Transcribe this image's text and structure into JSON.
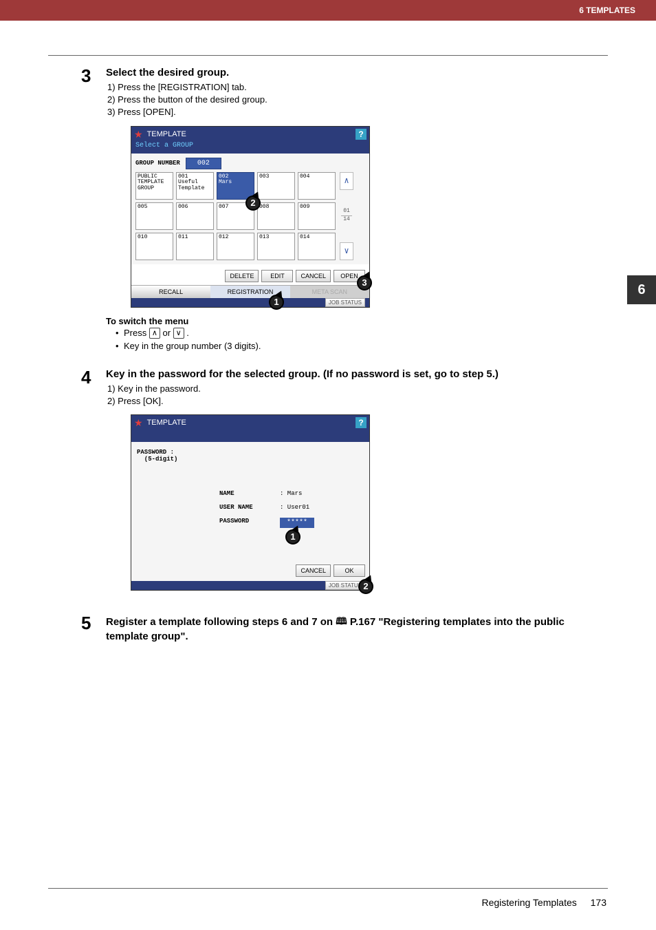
{
  "chapter_header": "6 TEMPLATES",
  "side_tab": "6",
  "steps": {
    "s3": {
      "num": "3",
      "title": "Select the desired group.",
      "lines": {
        "l1": "1)  Press the [REGISTRATION] tab.",
        "l2": "2)  Press the button of the desired group.",
        "l3": "3)  Press [OPEN]."
      },
      "switch_title": "To switch the menu",
      "switch_b1_pre": "Press ",
      "switch_b1_mid": " or ",
      "switch_b1_post": ".",
      "switch_b2": "Key in the group number (3 digits)."
    },
    "s4": {
      "num": "4",
      "title": "Key in the password for the selected group. (If no password is set, go to step 5.)",
      "lines": {
        "l1": "1)  Key in the password.",
        "l2": "2)  Press [OK]."
      }
    },
    "s5": {
      "num": "5",
      "title_pre": "Register a template following steps 6 and 7 on ",
      "title_ref": " P.167 \"Registering templates into the public template group\"."
    }
  },
  "screen1": {
    "title": "TEMPLATE",
    "subtitle": "Select a GROUP",
    "group_number_label": "GROUP NUMBER",
    "group_number_value": "002",
    "cells": {
      "c0": "PUBLIC TEMPLATE GROUP",
      "c1_n": "001",
      "c1_t": "Useful Template",
      "c2_n": "002",
      "c2_t": "Mars",
      "c3_n": "003",
      "c4_n": "004",
      "c5_n": "005",
      "c6_n": "006",
      "c7_n": "007",
      "c8_n": "008",
      "c9_n": "009",
      "c10_n": "010",
      "c11_n": "011",
      "c12_n": "012",
      "c13_n": "013",
      "c14_n": "014"
    },
    "page_cur": "01",
    "page_tot": "14",
    "buttons": {
      "delete": "DELETE",
      "edit": "EDIT",
      "cancel": "CANCEL",
      "open": "OPEN"
    },
    "tabs": {
      "recall": "RECALL",
      "registration": "REGISTRATION",
      "metascan": "META SCAN"
    },
    "jobstatus": "JOB STATUS"
  },
  "screen2": {
    "title": "TEMPLATE",
    "pwlabel": "PASSWORD :\n  (5-digit)",
    "rows": {
      "name_k": "NAME",
      "name_v": ": Mars",
      "user_k": "USER NAME",
      "user_v": ": User01",
      "pass_k": "PASSWORD",
      "pass_v": "*****"
    },
    "buttons": {
      "cancel": "CANCEL",
      "ok": "OK"
    },
    "jobstatus": "JOB STATUS"
  },
  "footer": {
    "section": "Registering Templates",
    "page": "173"
  },
  "icons": {
    "up": "⌃",
    "down": "⌄",
    "book": "▣"
  },
  "callouts": {
    "c1": "1",
    "c2": "2",
    "c3": "3"
  }
}
